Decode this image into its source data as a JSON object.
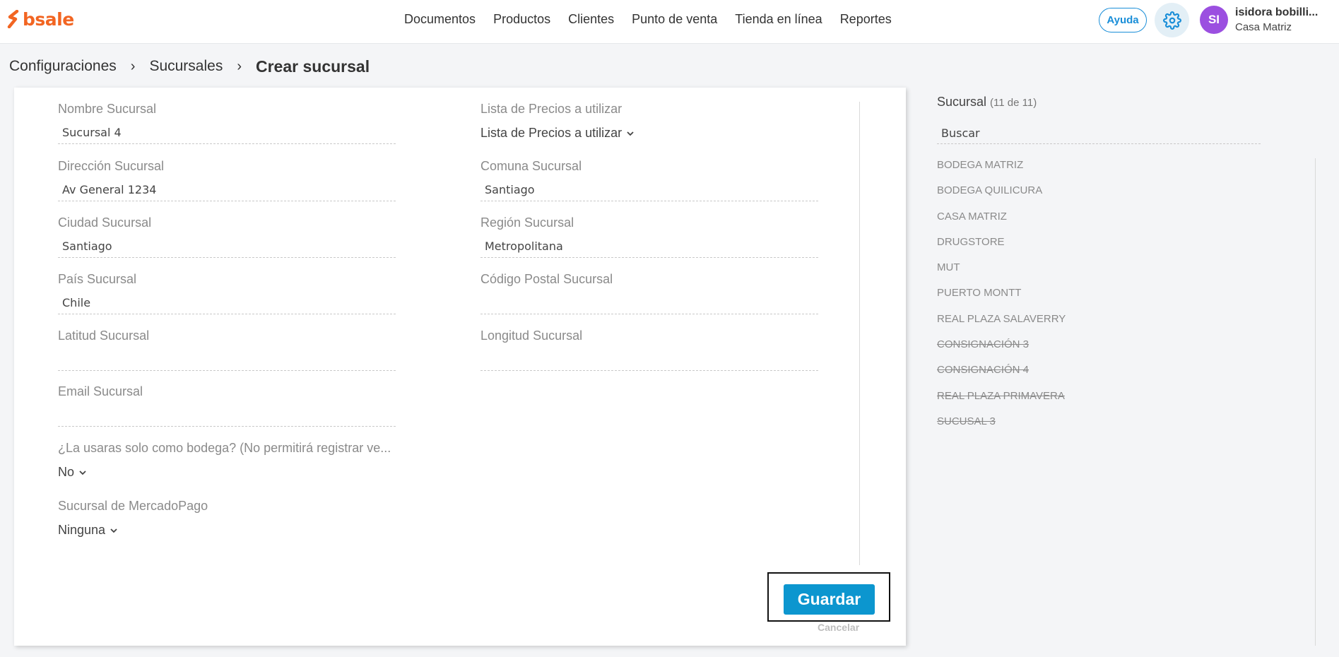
{
  "header": {
    "logo_text": "bsale",
    "nav": [
      "Documentos",
      "Productos",
      "Clientes",
      "Punto de venta",
      "Tienda en línea",
      "Reportes"
    ],
    "help_label": "Ayuda",
    "settings_icon": "gear-icon",
    "user": {
      "initials": "SI",
      "name": "isidora bobilli...",
      "branch": "Casa Matriz"
    }
  },
  "breadcrumb": {
    "items": [
      "Configuraciones",
      "Sucursales"
    ],
    "current": "Crear sucursal",
    "separator": "›"
  },
  "form": {
    "left": [
      {
        "label": "Nombre Sucursal",
        "value": "Sucursal 4"
      },
      {
        "label": "Dirección Sucursal",
        "value": "Av General 1234"
      },
      {
        "label": "Ciudad Sucursal",
        "value": "Santiago"
      },
      {
        "label": "País Sucursal",
        "value": "Chile"
      },
      {
        "label": "Latitud Sucursal",
        "value": ""
      },
      {
        "label": "Email Sucursal",
        "value": ""
      }
    ],
    "right": [
      {
        "label": "Comuna Sucursal",
        "value": "Santiago"
      },
      {
        "label": "Región Sucursal",
        "value": "Metropolitana"
      },
      {
        "label": "Código Postal Sucursal",
        "value": ""
      },
      {
        "label": "Longitud Sucursal",
        "value": ""
      }
    ],
    "price_list": {
      "label": "Lista de Precios a utilizar",
      "selected": "Lista de Precios a utilizar"
    },
    "warehouse_only": {
      "label": "¿La usaras solo como bodega? (No permitirá registrar ve...",
      "selected": "No"
    },
    "mercadopago": {
      "label": "Sucursal de MercadoPago",
      "selected": "Ninguna"
    },
    "save_label": "Guardar",
    "cancel_label": "Cancelar"
  },
  "sidebar": {
    "title": "Sucursal",
    "count": "(11 de 11)",
    "search_value": "Buscar",
    "items": [
      {
        "name": "BODEGA MATRIZ",
        "active": true
      },
      {
        "name": "BODEGA QUILICURA",
        "active": true
      },
      {
        "name": "CASA MATRIZ",
        "active": true
      },
      {
        "name": "DRUGSTORE",
        "active": true
      },
      {
        "name": "MUT",
        "active": true
      },
      {
        "name": "PUERTO MONTT",
        "active": true
      },
      {
        "name": "REAL PLAZA SALAVERRY",
        "active": true
      },
      {
        "name": "CONSIGNACIÓN 3",
        "active": false
      },
      {
        "name": "CONSIGNACIÓN 4",
        "active": false
      },
      {
        "name": "REAL PLAZA PRIMAVERA",
        "active": false
      },
      {
        "name": "SUCUSAL 3",
        "active": false
      }
    ]
  },
  "colors": {
    "brand": "#f26522",
    "accent": "#0c96cf",
    "avatar": "#9b4fe0",
    "help": "#1a8ed8"
  }
}
